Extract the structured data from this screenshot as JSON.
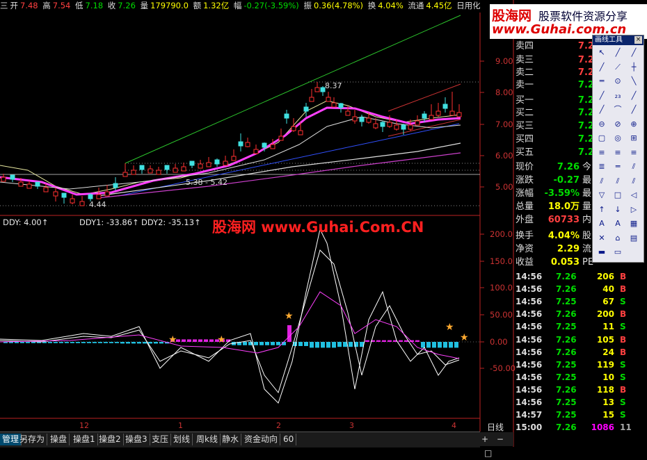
{
  "info": {
    "prefix": "三",
    "open_lbl": "开",
    "open": "7.48",
    "high_lbl": "高",
    "high": "7.54",
    "low_lbl": "低",
    "low": "7.18",
    "close_lbl": "收",
    "close": "7.26",
    "vol_lbl": "量",
    "vol": "179790.0",
    "amt_lbl": "额",
    "amt": "1.32亿",
    "chg_lbl": "幅",
    "chg": "-0.27(-3.59%)",
    "amp_lbl": "振",
    "amp": "0.36(4.78%)",
    "turn_lbl": "换",
    "turn": "4.04%",
    "float_lbl": "流通",
    "float": "4.45亿",
    "name": "日用化工"
  },
  "logo": {
    "main": "股海网",
    "slogan": "股票软件资源分享",
    "url": "www.Guhai.com.cn"
  },
  "watermark": "股海网 www.Guhai.Com.CN",
  "price_axis": [
    "9.00",
    "8.00",
    "7.00",
    "6.00",
    "5.00"
  ],
  "ind_axis": [
    "200.0",
    "150.0",
    "100.0",
    "50.00",
    "0.00",
    "-50.00"
  ],
  "annotations": {
    "peak": "8.37",
    "low": "4.44",
    "range": "5.38 - 5.42"
  },
  "indicators": [
    {
      "text": "DDY: 4.00↑",
      "color": "#e8e8e8"
    },
    {
      "text": "DDY1: -33.86↑",
      "color": "#e8e8e8"
    },
    {
      "text": "DDY2: -35.13↑",
      "color": "#e8e8e8"
    }
  ],
  "x_labels": [
    "12",
    "1",
    "2",
    "3",
    "4"
  ],
  "period": "日线",
  "quote": [
    {
      "label": "卖四",
      "value": "7.29",
      "vol": "",
      "color": "#ff4040"
    },
    {
      "label": "卖三",
      "value": "7.28",
      "vol": "",
      "color": "#ff4040"
    },
    {
      "label": "卖二",
      "value": "7.27",
      "vol": "",
      "color": "#ff4040"
    },
    {
      "label": "卖一",
      "value": "7.26",
      "vol": "",
      "color": "#00dd00"
    },
    {
      "label": "买一",
      "value": "7.25",
      "vol": "",
      "color": "#00dd00"
    },
    {
      "label": "买二",
      "value": "7.24",
      "vol": "",
      "color": "#00dd00"
    },
    {
      "label": "买三",
      "value": "7.23",
      "vol": "",
      "color": "#00dd00"
    },
    {
      "label": "买四",
      "value": "7.22",
      "vol": "",
      "color": "#00dd00"
    },
    {
      "label": "买五",
      "value": "7.21",
      "vol": "",
      "color": "#00dd00"
    }
  ],
  "stats": [
    {
      "label": "现价",
      "value": "7.26",
      "suffix": "今",
      "color": "#00dd00"
    },
    {
      "label": "涨跌",
      "value": "-0.27",
      "suffix": "最",
      "color": "#00dd00"
    },
    {
      "label": "涨幅",
      "value": "-3.59%",
      "suffix": "最",
      "color": "#00dd00"
    },
    {
      "label": "总量",
      "value": "18.0万",
      "suffix": "量",
      "color": "#ffff00"
    },
    {
      "label": "外盘",
      "value": "60733",
      "suffix": "内",
      "color": "#ff4040"
    },
    {
      "label": "换手",
      "value": "4.04%",
      "suffix": "股",
      "color": "#ffff00"
    },
    {
      "label": "净资",
      "value": "2.29",
      "suffix": "流",
      "color": "#ffff00"
    },
    {
      "label": "收益",
      "value": "0.053",
      "suffix": "PE",
      "color": "#ffff00"
    }
  ],
  "ticks": [
    {
      "time": "14:56",
      "price": "7.26",
      "vol": "206",
      "side": "B"
    },
    {
      "time": "14:56",
      "price": "7.26",
      "vol": "40",
      "side": "B"
    },
    {
      "time": "14:56",
      "price": "7.25",
      "vol": "67",
      "side": "S"
    },
    {
      "time": "14:56",
      "price": "7.26",
      "vol": "200",
      "side": "B"
    },
    {
      "time": "14:56",
      "price": "7.25",
      "vol": "11",
      "side": "S"
    },
    {
      "time": "14:56",
      "price": "7.26",
      "vol": "105",
      "side": "B"
    },
    {
      "time": "14:56",
      "price": "7.26",
      "vol": "24",
      "side": "B"
    },
    {
      "time": "14:56",
      "price": "7.25",
      "vol": "119",
      "side": "S"
    },
    {
      "time": "14:56",
      "price": "7.25",
      "vol": "10",
      "side": "S"
    },
    {
      "time": "14:56",
      "price": "7.26",
      "vol": "118",
      "side": "B"
    },
    {
      "time": "14:56",
      "price": "7.25",
      "vol": "13",
      "side": "S"
    },
    {
      "time": "14:57",
      "price": "7.25",
      "vol": "15",
      "side": "S"
    },
    {
      "time": "15:00",
      "price": "7.26",
      "vol": "1086",
      "side": "11"
    }
  ],
  "tabs": [
    "管理",
    "另存为",
    "操盘",
    "操盘1",
    "操盘2",
    "操盘3",
    "支压",
    "划线",
    "周k线",
    "静水",
    "资金动向",
    "60"
  ],
  "toolpanel": {
    "title": "画线工具",
    "close": "×"
  }
}
